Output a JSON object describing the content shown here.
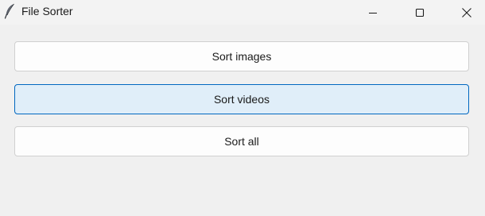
{
  "window": {
    "title": "File Sorter",
    "icon": "feather-icon",
    "controls": [
      "minimize-icon",
      "maximize-icon",
      "close-icon"
    ]
  },
  "buttons": [
    {
      "label": "Sort images",
      "state": "normal"
    },
    {
      "label": "Sort videos",
      "state": "hover"
    },
    {
      "label": "Sort all",
      "state": "normal"
    }
  ],
  "colors": {
    "window_background": "#f0f0f0",
    "button_background": "#fdfdfd",
    "button_border": "#d0d0d0",
    "hover_background": "#e0eef9",
    "hover_border": "#0067c0"
  }
}
